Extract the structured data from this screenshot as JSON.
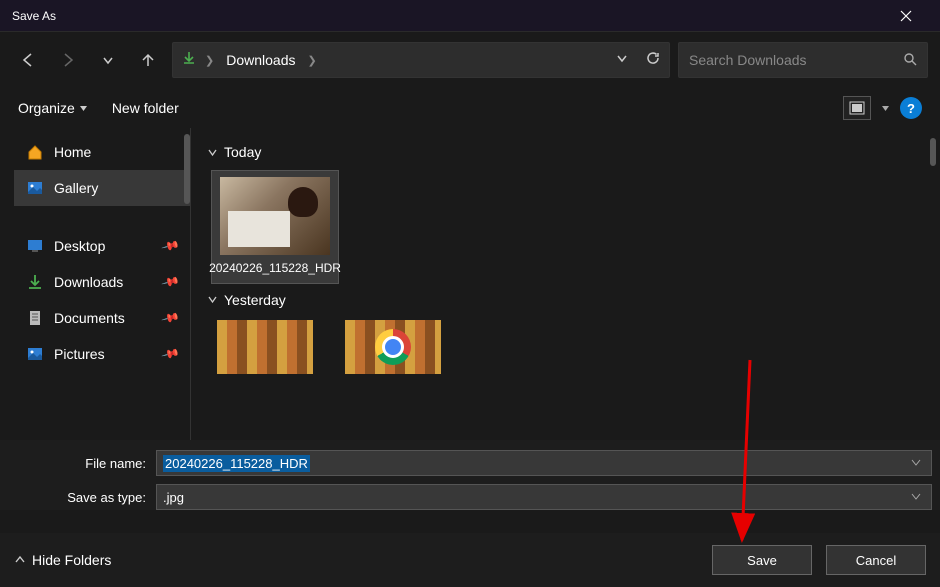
{
  "title": "Save As",
  "breadcrumb": {
    "location": "Downloads"
  },
  "search": {
    "placeholder": "Search Downloads"
  },
  "toolbar": {
    "organize": "Organize",
    "new_folder": "New folder"
  },
  "sidebar": {
    "items": [
      {
        "label": "Home",
        "icon": "home"
      },
      {
        "label": "Gallery",
        "icon": "gallery",
        "selected": true
      },
      {
        "label": "Desktop",
        "icon": "desktop",
        "pinned": true
      },
      {
        "label": "Downloads",
        "icon": "downloads",
        "pinned": true
      },
      {
        "label": "Documents",
        "icon": "documents",
        "pinned": true
      },
      {
        "label": "Pictures",
        "icon": "pictures",
        "pinned": true
      }
    ]
  },
  "content": {
    "sections": [
      {
        "label": "Today",
        "files": [
          {
            "label": "20240226_115228_HDR",
            "selected": true
          }
        ]
      },
      {
        "label": "Yesterday",
        "files": [
          {
            "label": ""
          },
          {
            "label": ""
          }
        ]
      }
    ]
  },
  "form": {
    "filename_label": "File name:",
    "filename_value": "20240226_115228_HDR",
    "savetype_label": "Save as type:",
    "savetype_value": ".jpg"
  },
  "footer": {
    "hide_folders": "Hide Folders",
    "save": "Save",
    "cancel": "Cancel"
  }
}
